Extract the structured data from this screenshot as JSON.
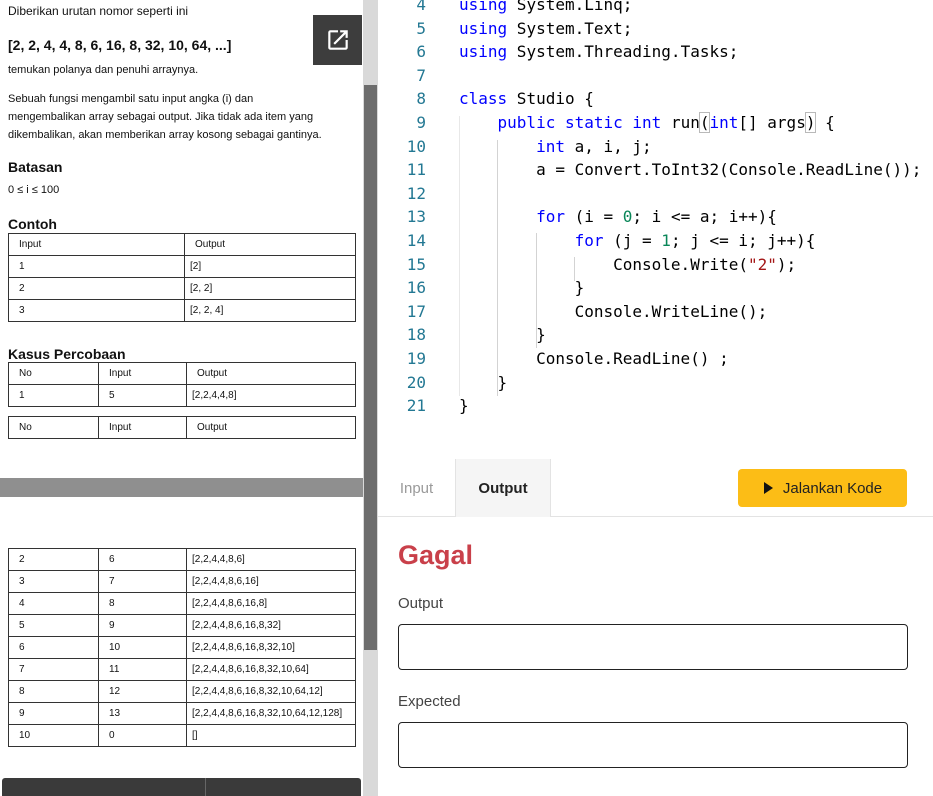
{
  "problem": {
    "intro": "Diberikan urutan nomor seperti ini",
    "sequence": "[2, 2, 4, 4, 8, 6, 16, 8, 32, 10, 64, ...]",
    "task": "temukan polanya dan penuhi arraynya.",
    "paragraph_line1": "Sebuah fungsi mengambil satu input angka (i) dan",
    "paragraph_line2": "mengembalikan array sebagai output. Jika tidak ada item yang",
    "paragraph_line3": "dikembalikan, akan memberikan array kosong sebagai gantinya.",
    "constraints_title": "Batasan",
    "constraint": "0 ≤ i ≤ 100",
    "examples_title": "Contoh",
    "examples_headers": [
      "Input",
      "Output"
    ],
    "examples_rows": [
      [
        "1",
        "[2]"
      ],
      [
        "2",
        "[2, 2]"
      ],
      [
        "3",
        "[2, 2, 4]"
      ]
    ],
    "testcases_title": "Kasus Percobaan",
    "testcases_headers": [
      "No",
      "Input",
      "Output"
    ],
    "testcases_first_row": [
      "1",
      "5",
      "[2,2,4,4,8]"
    ],
    "testcases_rows": [
      [
        "2",
        "6",
        "[2,2,4,4,8,6]"
      ],
      [
        "3",
        "7",
        "[2,2,4,4,8,6,16]"
      ],
      [
        "4",
        "8",
        "[2,2,4,4,8,6,16,8]"
      ],
      [
        "5",
        "9",
        "[2,2,4,4,8,6,16,8,32]"
      ],
      [
        "6",
        "10",
        "[2,2,4,4,8,6,16,8,32,10]"
      ],
      [
        "7",
        "11",
        "[2,2,4,4,8,6,16,8,32,10,64]"
      ],
      [
        "8",
        "12",
        "[2,2,4,4,8,6,16,8,32,10,64,12]"
      ],
      [
        "9",
        "13",
        "[2,2,4,4,8,6,16,8,32,10,64,12,128]"
      ],
      [
        "10",
        "0",
        "[]"
      ]
    ]
  },
  "editor": {
    "lines": [
      {
        "n": "4",
        "tokens": [
          [
            "kw",
            "using"
          ],
          [
            "",
            " System.Linq;"
          ]
        ]
      },
      {
        "n": "5",
        "tokens": [
          [
            "kw",
            "using"
          ],
          [
            "",
            " System.Text;"
          ]
        ]
      },
      {
        "n": "6",
        "tokens": [
          [
            "kw",
            "using"
          ],
          [
            "",
            " System.Threading.Tasks;"
          ]
        ]
      },
      {
        "n": "7",
        "tokens": []
      },
      {
        "n": "8",
        "tokens": [
          [
            "kw",
            "class"
          ],
          [
            "",
            " Studio {"
          ]
        ]
      },
      {
        "n": "9",
        "tokens": [
          [
            "",
            "    "
          ],
          [
            "kw",
            "public"
          ],
          [
            "",
            " "
          ],
          [
            "kw",
            "static"
          ],
          [
            "",
            " "
          ],
          [
            "kw",
            "int"
          ],
          [
            "",
            " run"
          ],
          [
            "brk",
            "("
          ],
          [
            "kw",
            "int"
          ],
          [
            "",
            "[] args"
          ],
          [
            "brk",
            ")"
          ],
          [
            "",
            " {"
          ]
        ]
      },
      {
        "n": "10",
        "tokens": [
          [
            "",
            "        "
          ],
          [
            "kw",
            "int"
          ],
          [
            "",
            " a, i, j;"
          ]
        ]
      },
      {
        "n": "11",
        "tokens": [
          [
            "",
            "        a = Convert.ToInt32(Console.ReadLine());"
          ]
        ]
      },
      {
        "n": "12",
        "tokens": []
      },
      {
        "n": "13",
        "tokens": [
          [
            "",
            "        "
          ],
          [
            "kw",
            "for"
          ],
          [
            "",
            " (i = "
          ],
          [
            "num",
            "0"
          ],
          [
            "",
            "; i <= a; i++){"
          ]
        ]
      },
      {
        "n": "14",
        "tokens": [
          [
            "",
            "            "
          ],
          [
            "kw",
            "for"
          ],
          [
            "",
            " (j = "
          ],
          [
            "num",
            "1"
          ],
          [
            "",
            "; j <= i; j++){"
          ]
        ]
      },
      {
        "n": "15",
        "tokens": [
          [
            "",
            "                Console.Write("
          ],
          [
            "str",
            "\"2\""
          ],
          [
            "",
            ");"
          ]
        ]
      },
      {
        "n": "16",
        "tokens": [
          [
            "",
            "            }"
          ]
        ]
      },
      {
        "n": "17",
        "tokens": [
          [
            "",
            "            Console.WriteLine();"
          ]
        ]
      },
      {
        "n": "18",
        "tokens": [
          [
            "",
            "        }"
          ]
        ]
      },
      {
        "n": "19",
        "tokens": [
          [
            "",
            "        Console.ReadLine() ;"
          ]
        ]
      },
      {
        "n": "20",
        "tokens": [
          [
            "",
            "    }"
          ]
        ]
      },
      {
        "n": "21",
        "tokens": [
          [
            "",
            "}"
          ]
        ]
      }
    ]
  },
  "tabs": {
    "input_label": "Input",
    "output_label": "Output",
    "active": "Output"
  },
  "run_button": {
    "label": "Jalankan Kode",
    "color": "#fcbd16"
  },
  "result": {
    "status": "Gagal",
    "status_color": "#c9404a",
    "output_label": "Output",
    "output_value": "",
    "expected_label": "Expected",
    "expected_value": ""
  },
  "icons": {
    "open_external": "open-in-new-icon",
    "play": "play-icon"
  }
}
